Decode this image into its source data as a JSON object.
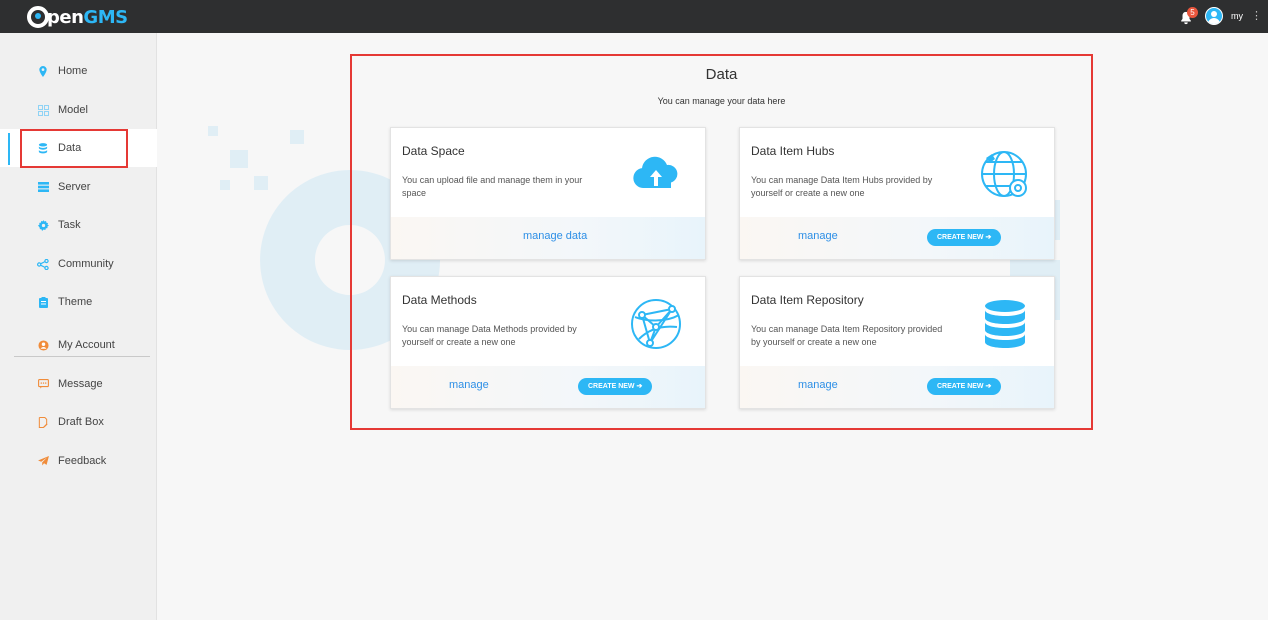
{
  "header": {
    "logo_prefix": "O",
    "logo_pen": "pen",
    "logo_gms": "GMS",
    "notification_count": "5",
    "username": "my",
    "menu_glyph": "⋮"
  },
  "sidebar": {
    "items": [
      {
        "label": "Home",
        "icon": "location-pin-icon"
      },
      {
        "label": "Model",
        "icon": "grid-icon"
      },
      {
        "label": "Data",
        "icon": "database-icon"
      },
      {
        "label": "Server",
        "icon": "server-icon"
      },
      {
        "label": "Task",
        "icon": "gear-icon"
      },
      {
        "label": "Community",
        "icon": "share-icon"
      },
      {
        "label": "Theme",
        "icon": "clipboard-icon"
      },
      {
        "label": "My Account",
        "icon": "user-circle-icon"
      },
      {
        "label": "Message",
        "icon": "message-icon"
      },
      {
        "label": "Draft Box",
        "icon": "draft-icon"
      },
      {
        "label": "Feedback",
        "icon": "paper-plane-icon"
      }
    ],
    "active": "Data"
  },
  "main": {
    "title": "Data",
    "subtitle": "You can manage your data here",
    "cards": [
      {
        "title": "Data Space",
        "desc": "You can upload file and manage them in your space",
        "link": "manage data",
        "icon": "cloud-upload-icon"
      },
      {
        "title": "Data Item Hubs",
        "desc": "You can manage Data Item Hubs provided by yourself or create a new one",
        "link": "manage",
        "button": "CREATE NEW ➔",
        "icon": "globe-gear-icon"
      },
      {
        "title": "Data Methods",
        "desc": "You can manage Data Methods provided by yourself or create a new one",
        "link": "manage",
        "button": "CREATE NEW ➔",
        "icon": "network-sphere-icon"
      },
      {
        "title": "Data Item Repository",
        "desc": "You can manage Data Item Repository provided by yourself or create a new one",
        "link": "manage",
        "button": "CREATE NEW ➔",
        "icon": "database-stack-icon"
      }
    ]
  },
  "colors": {
    "accent": "#2db7f5",
    "topbar": "#2e2f30",
    "highlight": "#e53935",
    "link": "#2d8fe6"
  }
}
